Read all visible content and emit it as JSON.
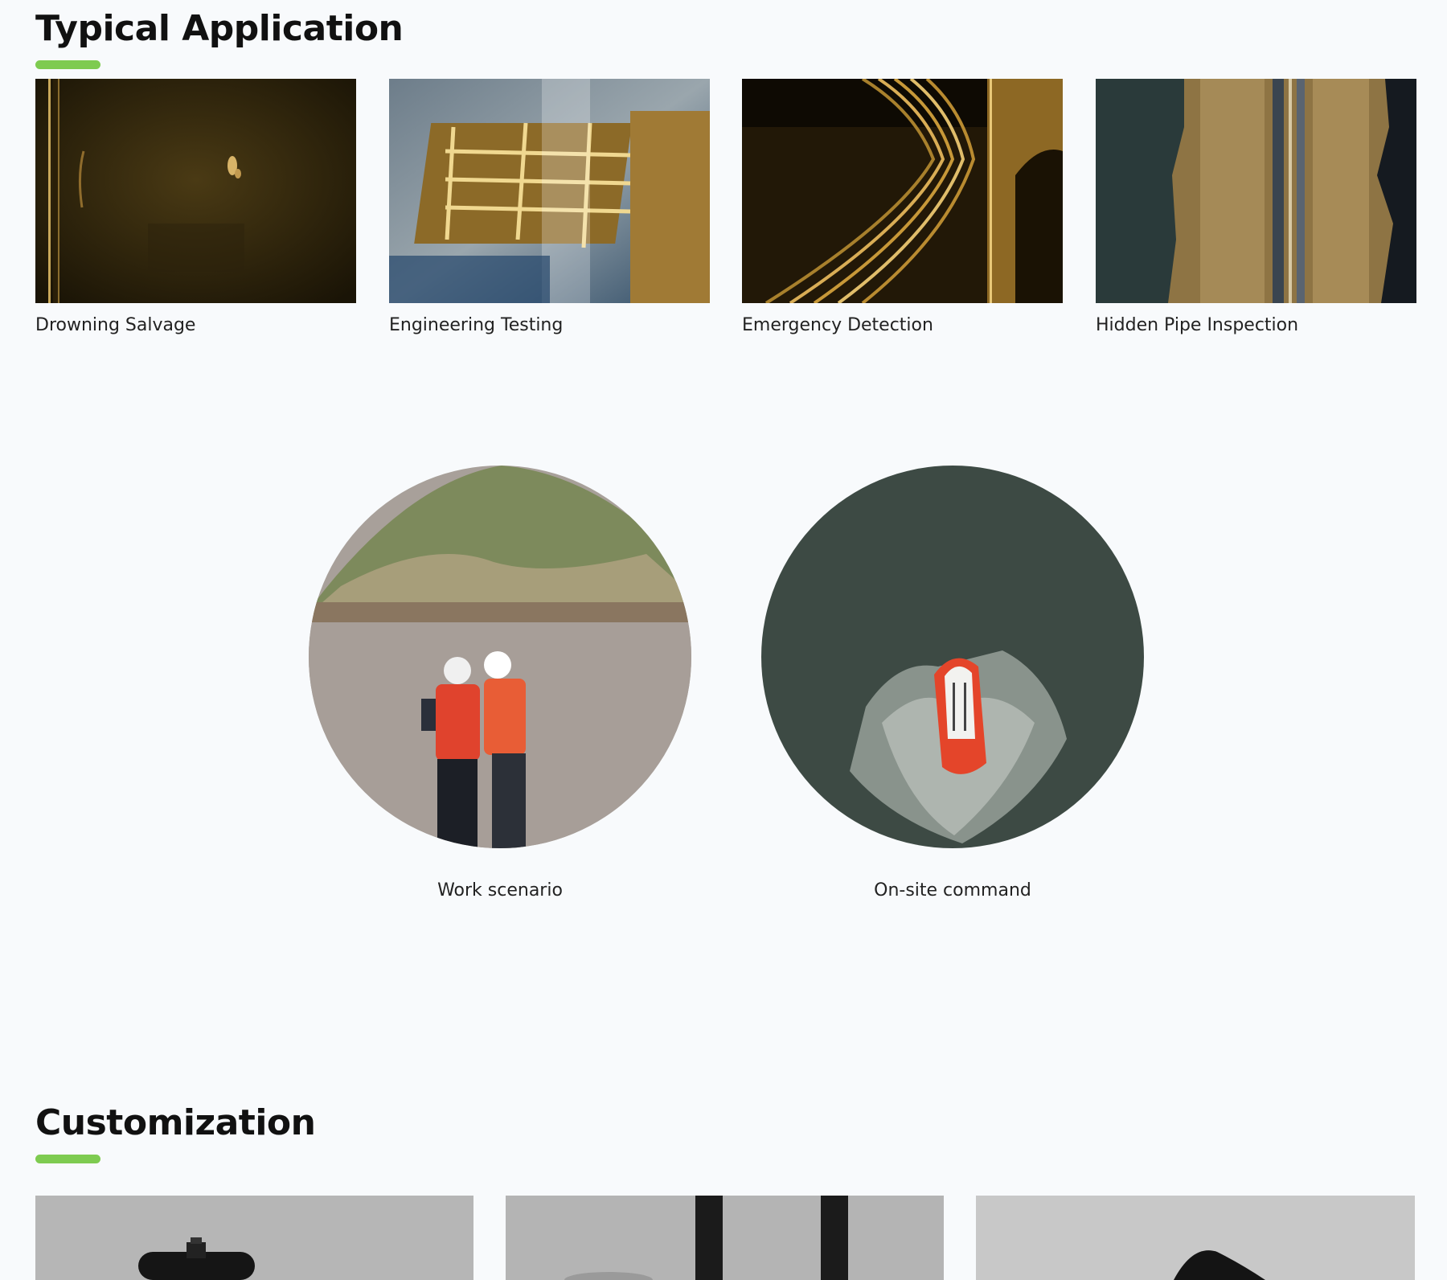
{
  "typical_application": {
    "title": "Typical Application",
    "accent_color": "#7ecb50",
    "items": [
      {
        "caption": "Drowning Salvage",
        "image": "sonar-image-drowning-salvage"
      },
      {
        "caption": "Engineering Testing",
        "image": "sonar-image-engineering-testing"
      },
      {
        "caption": "Emergency Detection",
        "image": "sonar-image-emergency-detection"
      },
      {
        "caption": "Hidden Pipe Inspection",
        "image": "sonar-image-hidden-pipe-inspection"
      }
    ]
  },
  "scenes": [
    {
      "caption": "Work scenario",
      "image": "workers-at-riverbank-photo"
    },
    {
      "caption": "On-site command",
      "image": "orange-survey-boat-aerial-photo"
    }
  ],
  "customization": {
    "title": "Customization",
    "accent_color": "#7ecb50",
    "cards": [
      {
        "image": "sonar-device-product-photo"
      },
      {
        "image": "mounting-pole-product-photo"
      },
      {
        "image": "transducer-product-photo"
      }
    ]
  }
}
